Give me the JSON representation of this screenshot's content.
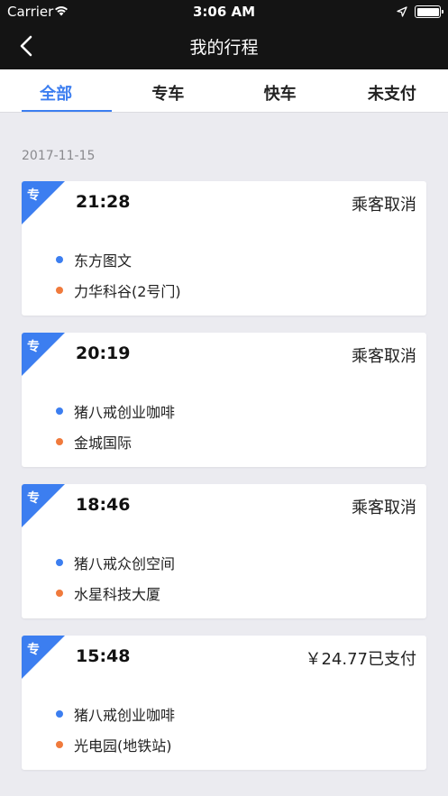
{
  "status_bar": {
    "carrier": "Carrier",
    "time": "3:06 AM"
  },
  "nav": {
    "title": "我的行程",
    "back_icon": "chevron-left-icon"
  },
  "tabs": [
    {
      "label": "全部",
      "active": true
    },
    {
      "label": "专车",
      "active": false
    },
    {
      "label": "快车",
      "active": false
    },
    {
      "label": "未支付",
      "active": false
    }
  ],
  "date_header": "2017-11-15",
  "colors": {
    "accent": "#3c7ef0",
    "start_dot": "#3c7ef0",
    "end_dot": "#f07a3c",
    "nav_bg": "#141414"
  },
  "trips": [
    {
      "tag": "专",
      "time": "21:28",
      "status": "乘客取消",
      "from": "东方图文",
      "to": "力华科谷(2号门)"
    },
    {
      "tag": "专",
      "time": "20:19",
      "status": "乘客取消",
      "from": "猪八戒创业咖啡",
      "to": "金城国际"
    },
    {
      "tag": "专",
      "time": "18:46",
      "status": "乘客取消",
      "from": "猪八戒众创空间",
      "to": "水星科技大厦"
    },
    {
      "tag": "专",
      "time": "15:48",
      "status": "￥24.77已支付",
      "from": "猪八戒创业咖啡",
      "to": "光电园(地铁站)"
    }
  ]
}
